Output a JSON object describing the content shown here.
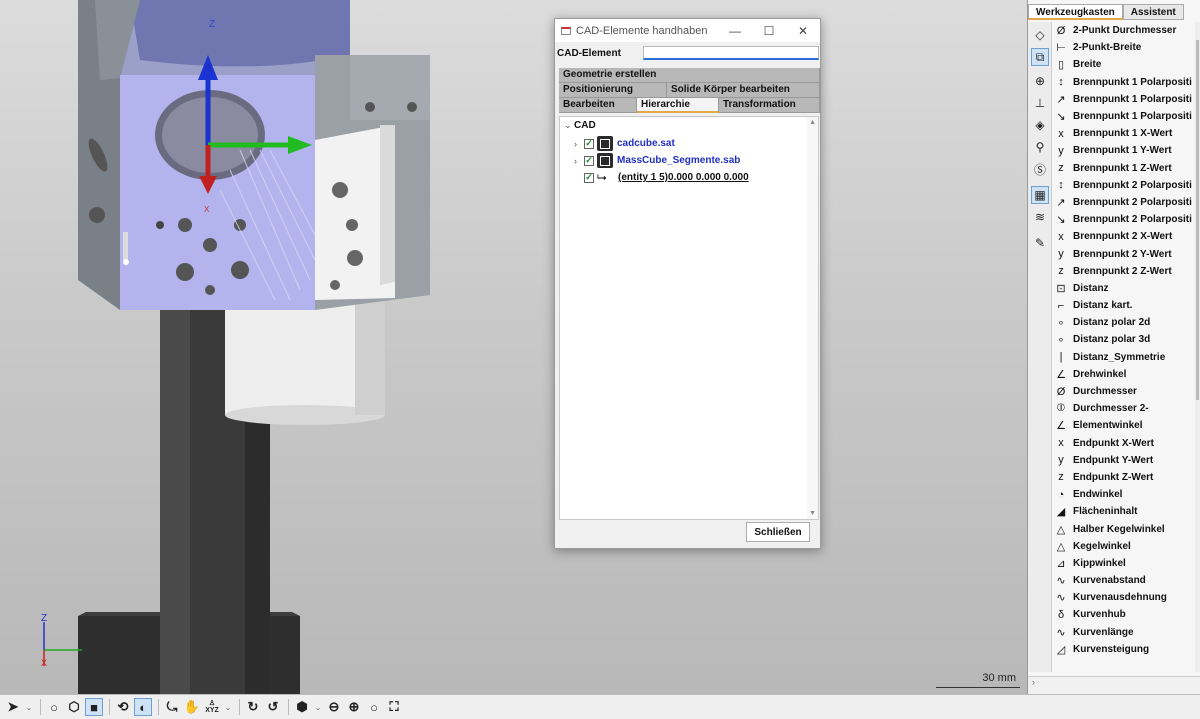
{
  "viewport": {
    "scale_label": "30 mm",
    "axis_z": "Z",
    "axis_x": "X",
    "triad_z": "Z",
    "triad_x": "X"
  },
  "dialog": {
    "title": "CAD-Elemente handhaben",
    "minimize": "—",
    "maximize": "☐",
    "close": "✕",
    "cad_element_label": "CAD-Element",
    "cad_element_value": "",
    "tabs_row1": [
      "Geometrie erstellen"
    ],
    "tabs_row2": [
      "Positionierung",
      "Solide Körper bearbeiten"
    ],
    "tabs_row3": [
      "Bearbeiten",
      "Hierarchie",
      "Transformation"
    ],
    "active_tab": "Hierarchie",
    "tree": {
      "root": "CAD",
      "items": [
        {
          "label": "cadcube.sat",
          "checked": true
        },
        {
          "label": "MassCube_Segmente.sab",
          "checked": true
        },
        {
          "label": "(entity 1 5)0.000 0.000 0.000",
          "checked": true
        }
      ]
    },
    "close_button": "Schließen"
  },
  "right_panel": {
    "tabs": [
      "Werkzeugkasten",
      "Assistent"
    ],
    "active_tab": "Werkzeugkasten",
    "tools": [
      {
        "icon": "Ø",
        "label": "2-Punkt Durchmesser"
      },
      {
        "icon": "⊢",
        "label": "2-Punkt-Breite"
      },
      {
        "icon": "▯",
        "label": "Breite"
      },
      {
        "icon": "↕",
        "label": "Brennpunkt 1 Polarpositi"
      },
      {
        "icon": "↗",
        "label": "Brennpunkt 1 Polarpositi"
      },
      {
        "icon": "↘",
        "label": "Brennpunkt 1 Polarpositi"
      },
      {
        "icon": "x",
        "label": "Brennpunkt 1 X-Wert"
      },
      {
        "icon": "y",
        "label": "Brennpunkt 1 Y-Wert"
      },
      {
        "icon": "z",
        "label": "Brennpunkt 1 Z-Wert"
      },
      {
        "icon": "↕",
        "label": "Brennpunkt 2 Polarpositi"
      },
      {
        "icon": "↗",
        "label": "Brennpunkt 2 Polarpositi"
      },
      {
        "icon": "↘",
        "label": "Brennpunkt 2 Polarpositi"
      },
      {
        "icon": "x",
        "label": "Brennpunkt 2 X-Wert"
      },
      {
        "icon": "y",
        "label": "Brennpunkt 2 Y-Wert"
      },
      {
        "icon": "z",
        "label": "Brennpunkt 2 Z-Wert"
      },
      {
        "icon": "⊡",
        "label": "Distanz"
      },
      {
        "icon": "⌐",
        "label": "Distanz kart."
      },
      {
        "icon": "∘",
        "label": "Distanz polar 2d"
      },
      {
        "icon": "∘",
        "label": "Distanz polar 3d"
      },
      {
        "icon": "|",
        "label": "Distanz_Symmetrie"
      },
      {
        "icon": "∠",
        "label": "Drehwinkel"
      },
      {
        "icon": "Ø",
        "label": "Durchmesser"
      },
      {
        "icon": "⦶",
        "label": "Durchmesser 2-"
      },
      {
        "icon": "∠",
        "label": "Elementwinkel"
      },
      {
        "icon": "x",
        "label": "Endpunkt X-Wert"
      },
      {
        "icon": "y",
        "label": "Endpunkt Y-Wert"
      },
      {
        "icon": "z",
        "label": "Endpunkt Z-Wert"
      },
      {
        "icon": "◔",
        "label": "Endwinkel"
      },
      {
        "icon": "◢",
        "label": "Flächeninhalt"
      },
      {
        "icon": "△",
        "label": "Halber Kegelwinkel"
      },
      {
        "icon": "△",
        "label": "Kegelwinkel"
      },
      {
        "icon": "⊿",
        "label": "Kippwinkel"
      },
      {
        "icon": "∿",
        "label": "Kurvenabstand"
      },
      {
        "icon": "∿",
        "label": "Kurvenausdehnung"
      },
      {
        "icon": "δ",
        "label": "Kurvenhub"
      },
      {
        "icon": "∿",
        "label": "Kurvenlänge"
      },
      {
        "icon": "◿",
        "label": "Kurvensteigung"
      }
    ]
  },
  "bottom_toolbar": {
    "buttons": [
      "select-arrow",
      "dropdown",
      "circle",
      "sphere-outline",
      "solid-cube",
      "shaded",
      "shaded-active",
      "rotate-3d",
      "pan-hand",
      "xyz-view",
      "dropdown",
      "rotate-cw",
      "rotate-ccw",
      "cube-view",
      "dropdown",
      "zoom-out",
      "zoom-in",
      "zoom",
      "zoom-fit"
    ],
    "xyz_label": "XYZ"
  }
}
